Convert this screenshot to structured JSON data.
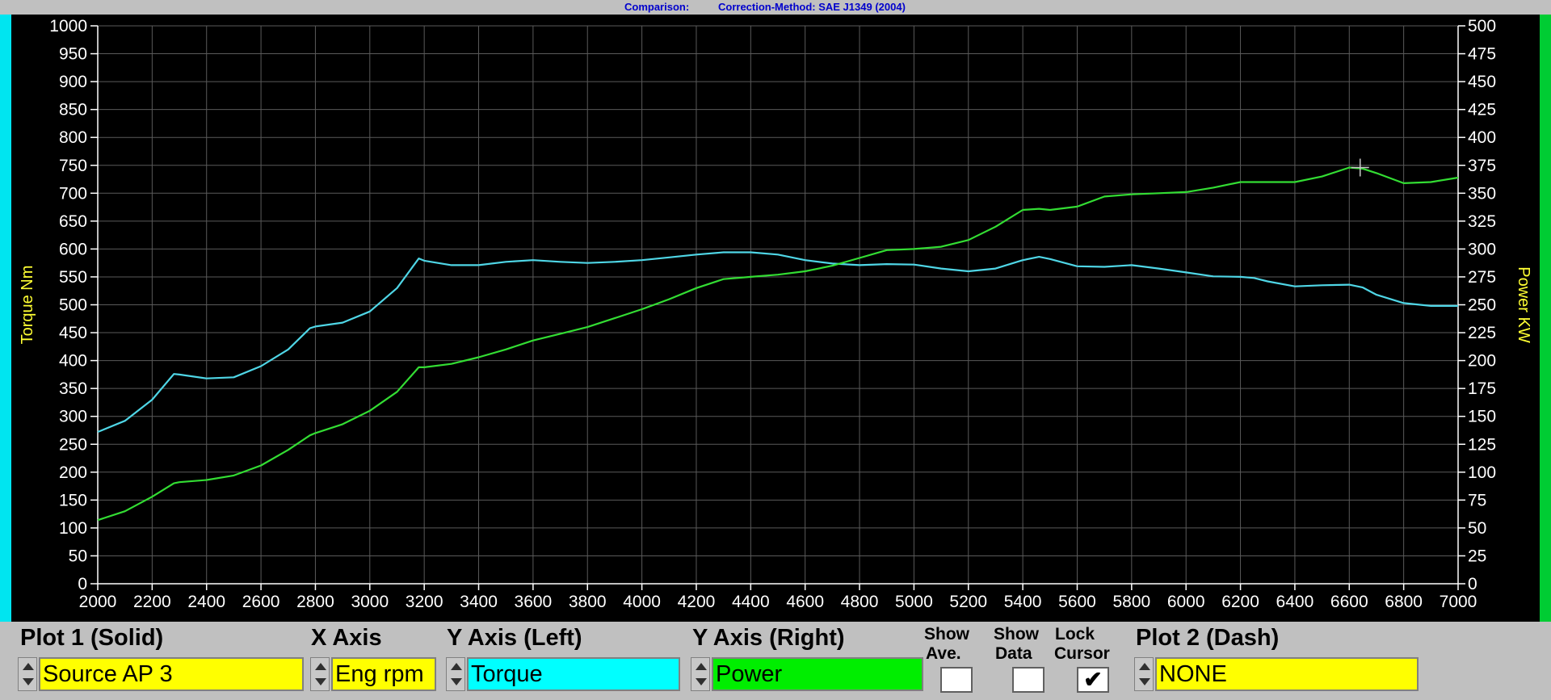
{
  "header": {
    "comparison_label": "Comparison:",
    "correction_label": "Correction-Method: SAE J1349 (2004)"
  },
  "colors": {
    "torque_line": "#4fd6e6",
    "power_line": "#33dd33",
    "axis_text": "#ffffff",
    "axis_title": "#ffff33",
    "grid": "#5a5a5a",
    "cursor": "#c8c8c8"
  },
  "chart_data": {
    "type": "line",
    "x": [
      2000,
      2100,
      2200,
      2280,
      2300,
      2400,
      2500,
      2600,
      2700,
      2780,
      2800,
      2900,
      3000,
      3100,
      3180,
      3200,
      3300,
      3400,
      3500,
      3600,
      3700,
      3800,
      3900,
      4000,
      4100,
      4200,
      4300,
      4400,
      4500,
      4600,
      4700,
      4800,
      4900,
      5000,
      5100,
      5200,
      5300,
      5400,
      5460,
      5500,
      5600,
      5700,
      5800,
      5900,
      6000,
      6100,
      6200,
      6250,
      6300,
      6400,
      6500,
      6600,
      6650,
      6700,
      6800,
      6900,
      7000
    ],
    "series": [
      {
        "axis": "left",
        "values": [
          272,
          292,
          330,
          376,
          375,
          368,
          370,
          390,
          420,
          458,
          461,
          468,
          488,
          530,
          583,
          579,
          571,
          571,
          577,
          580,
          577,
          575,
          577,
          580,
          585,
          590,
          594,
          594,
          590,
          580,
          574,
          571,
          573,
          572,
          565,
          560,
          565,
          580,
          586,
          582,
          569,
          568,
          571,
          565,
          558,
          551,
          550,
          548,
          542,
          533,
          535,
          536,
          531,
          518,
          503,
          498,
          498
        ]
      },
      {
        "axis": "right",
        "values": [
          57,
          65,
          78,
          90,
          91,
          93,
          97,
          106,
          120,
          133,
          135,
          143,
          155,
          172,
          194,
          194,
          197,
          203,
          210,
          218,
          224,
          230,
          238,
          246,
          255,
          265,
          273,
          275,
          277,
          280,
          285,
          292,
          299,
          300,
          302,
          308,
          320,
          335,
          336,
          335,
          338,
          347,
          349,
          350,
          351,
          355,
          360,
          360,
          360,
          360,
          365,
          373,
          372,
          368,
          359,
          360,
          364
        ]
      }
    ],
    "xlim": [
      2000,
      7000
    ],
    "xticks": [
      2000,
      2200,
      2400,
      2600,
      2800,
      3000,
      3200,
      3400,
      3600,
      3800,
      4000,
      4200,
      4400,
      4600,
      4800,
      5000,
      5200,
      5400,
      5600,
      5800,
      6000,
      6200,
      6400,
      6600,
      6800,
      7000
    ],
    "ylim_left": [
      0,
      1000
    ],
    "yticks_left": [
      0,
      50,
      100,
      150,
      200,
      250,
      300,
      350,
      400,
      450,
      500,
      550,
      600,
      650,
      700,
      750,
      800,
      850,
      900,
      950,
      1000
    ],
    "ylim_right": [
      0,
      500
    ],
    "yticks_right": [
      0,
      25,
      50,
      75,
      100,
      125,
      150,
      175,
      200,
      225,
      250,
      275,
      300,
      325,
      350,
      375,
      400,
      425,
      450,
      475,
      500
    ],
    "ylabel_left": "Torque Nm",
    "ylabel_right": "Power KW",
    "grid": true,
    "cursor": {
      "x": 6640,
      "y_right": 373
    }
  },
  "controls": {
    "plot1": {
      "title": "Plot 1 (Solid)",
      "value": "Source AP 3",
      "bg": "#ffff00"
    },
    "xaxis": {
      "title": "X Axis",
      "value": "Eng rpm",
      "bg": "#ffff00"
    },
    "yleft": {
      "title": "Y Axis (Left)",
      "value": "Torque",
      "bg": "#00ffff"
    },
    "yright": {
      "title": "Y Axis (Right)",
      "value": "Power",
      "bg": "#00ee00"
    },
    "show_ave": {
      "line1": "Show",
      "line2": "Ave.",
      "checked": false
    },
    "show_data": {
      "line1": "Show",
      "line2": "Data",
      "checked": false
    },
    "lock_cursor": {
      "line1": "Lock",
      "line2": "Cursor",
      "checked": true,
      "mark": "✔"
    },
    "plot2": {
      "title": "Plot 2 (Dash)",
      "value": "NONE",
      "bg": "#ffff00"
    }
  }
}
